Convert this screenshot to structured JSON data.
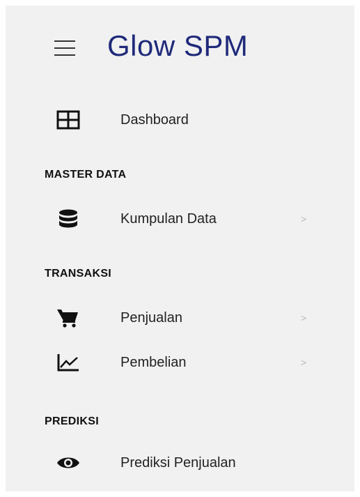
{
  "brand": {
    "title": "Glow SPM",
    "menu_icon": "hamburger-icon"
  },
  "nav": {
    "dashboard": {
      "label": "Dashboard",
      "icon": "grid-icon"
    },
    "kumpulan_data": {
      "label": "Kumpulan Data",
      "icon": "database-icon",
      "chevron": ">"
    },
    "penjualan": {
      "label": "Penjualan",
      "icon": "cart-icon",
      "chevron": ">"
    },
    "pembelian": {
      "label": "Pembelian",
      "icon": "line-chart-icon",
      "chevron": ">"
    },
    "prediksi_penjualan": {
      "label": "Prediksi Penjualan",
      "icon": "eye-icon"
    }
  },
  "sections": {
    "master_data": "MASTER DATA",
    "transaksi": "TRANSAKSI",
    "prediksi": "PREDIKSI"
  },
  "colors": {
    "brand": "#1f2a7a",
    "sidebar_bg": "#f1f1f1",
    "text": "#222222"
  }
}
